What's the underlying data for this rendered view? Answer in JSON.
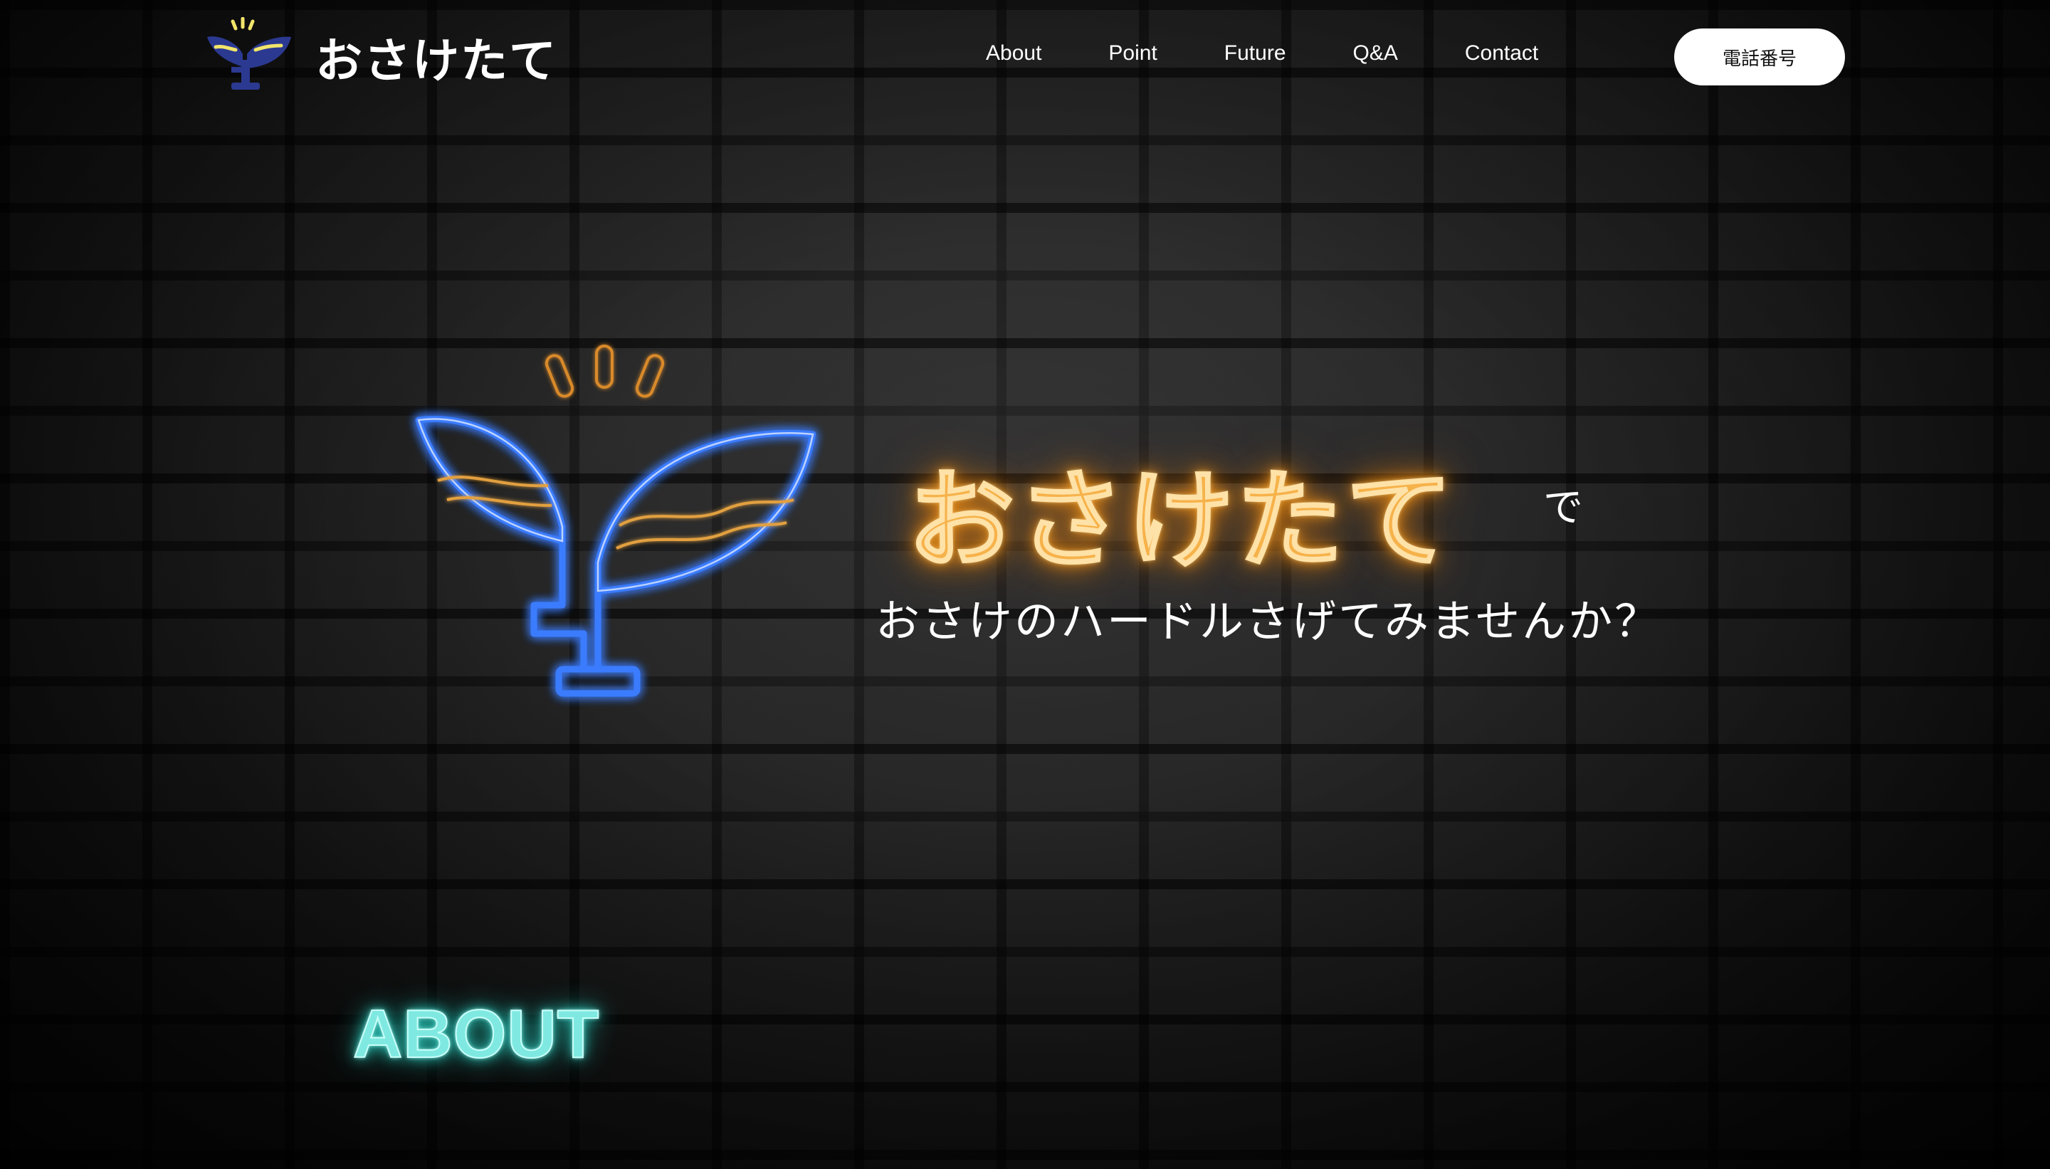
{
  "header": {
    "logo_text": "おさけたて",
    "nav": [
      {
        "label": "About"
      },
      {
        "label": "Point"
      },
      {
        "label": "Future"
      },
      {
        "label": "Q&A"
      },
      {
        "label": "Contact"
      }
    ],
    "phone_button_label": "電話番号"
  },
  "hero": {
    "title": "おさけたて",
    "particle": "で",
    "tagline": "おさけのハードルさげてみませんか？",
    "emblem_icon": "neon-sprout-glass-icon"
  },
  "about": {
    "heading": "ABOUT"
  },
  "colors": {
    "neon_orange": "#f6b24a",
    "neon_blue": "#2f6bff",
    "neon_cyan": "#7fe9e1",
    "logo_yellow": "#f2e56b",
    "logo_navy": "#2b3990"
  }
}
